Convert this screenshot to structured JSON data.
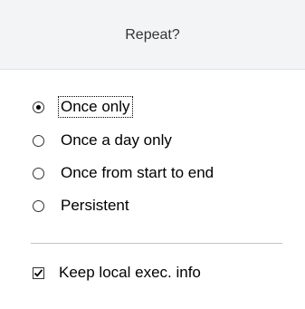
{
  "header": {
    "title": "Repeat?"
  },
  "repeat_options": [
    {
      "label": "Once only",
      "selected": true
    },
    {
      "label": "Once a day only",
      "selected": false
    },
    {
      "label": "Once from start to end",
      "selected": false
    },
    {
      "label": "Persistent",
      "selected": false
    }
  ],
  "keep_local": {
    "label": "Keep local exec. info",
    "checked": true
  },
  "colors": {
    "header_bg": "#f3f4f6",
    "divider": "#c4c4c4"
  }
}
